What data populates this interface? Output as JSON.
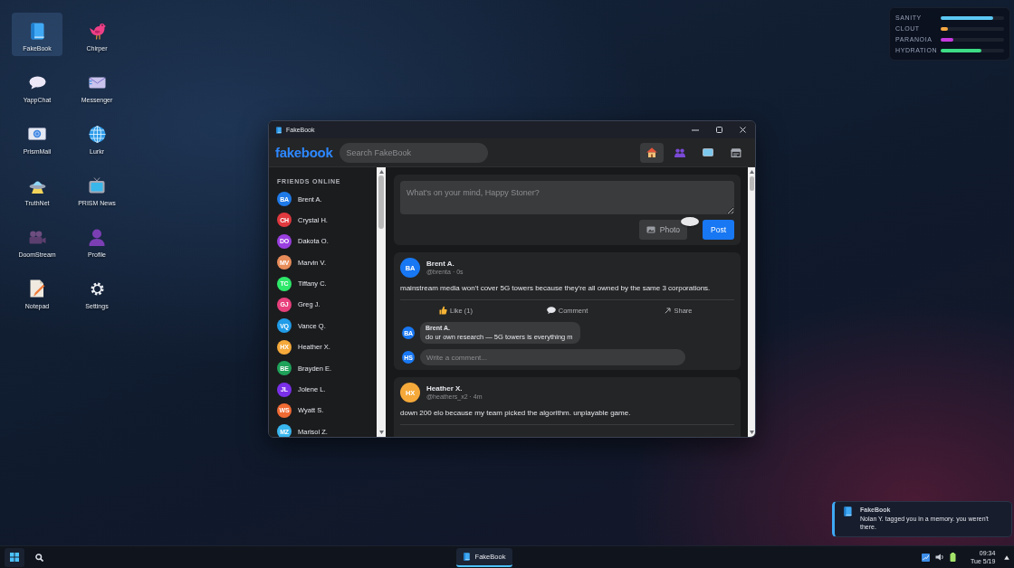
{
  "desktop_icons": [
    {
      "label": "FakeBook",
      "selected": true
    },
    {
      "label": "Chirper",
      "selected": false
    },
    {
      "label": "YappChat",
      "selected": false
    },
    {
      "label": "Messenger",
      "selected": false
    },
    {
      "label": "PrismMail",
      "selected": false
    },
    {
      "label": "Lurkr",
      "selected": false
    },
    {
      "label": "TruthNet",
      "selected": false
    },
    {
      "label": "PRISM News",
      "selected": false
    },
    {
      "label": "DoomStream",
      "selected": false
    },
    {
      "label": "Profile",
      "selected": false
    },
    {
      "label": "Notepad",
      "selected": false
    },
    {
      "label": "Settings",
      "selected": false
    }
  ],
  "status_meters": [
    {
      "label": "SANITY",
      "level": 0.83,
      "color": "#5cc8f4"
    },
    {
      "label": "CLOUT",
      "level": 0.11,
      "color": "#f5a742"
    },
    {
      "label": "PARANOIA",
      "level": 0.2,
      "color": "#c63ade"
    },
    {
      "label": "HYDRATION",
      "level": 0.64,
      "color": "#3ddc84"
    }
  ],
  "window": {
    "title": "FakeBook",
    "header": {
      "logo": "fakebook",
      "search": {
        "placeholder": "Search FakeBook"
      },
      "nav_tabs": [
        {
          "selected": true
        },
        {
          "selected": false
        },
        {
          "selected": false
        },
        {
          "selected": false
        }
      ]
    },
    "sidebar": {
      "heading": "FRIENDS ONLINE",
      "friends": [
        {
          "initials": "BA",
          "name": "Brent A.",
          "color": "#1f7ae8"
        },
        {
          "initials": "CH",
          "name": "Crystal H.",
          "color": "#e0393e"
        },
        {
          "initials": "DO",
          "name": "Dakota O.",
          "color": "#9a3fe0"
        },
        {
          "initials": "MV",
          "name": "Marvin V.",
          "color": "#e88d5a"
        },
        {
          "initials": "TC",
          "name": "Tiffany C.",
          "color": "#2ee86a"
        },
        {
          "initials": "GJ",
          "name": "Greg J.",
          "color": "#e8407c"
        },
        {
          "initials": "VQ",
          "name": "Vance Q.",
          "color": "#209ce8"
        },
        {
          "initials": "HX",
          "name": "Heather X.",
          "color": "#f5a93a"
        },
        {
          "initials": "BE",
          "name": "Brayden E.",
          "color": "#1fa25a"
        },
        {
          "initials": "JL",
          "name": "Jolene L.",
          "color": "#7a2fe8"
        },
        {
          "initials": "WS",
          "name": "Wyatt S.",
          "color": "#f06a33"
        },
        {
          "initials": "MZ",
          "name": "Marisol Z.",
          "color": "#3ab6ee"
        }
      ]
    },
    "composer": {
      "placeholder": "What's on your mind, Happy Stoner?",
      "buttons": [
        {
          "kind": "photo",
          "label": "Photo"
        },
        {
          "kind": "post",
          "label": "Post"
        }
      ]
    },
    "posts": [
      {
        "initials": "BA",
        "color": "#1877f2",
        "author": "Brent A.",
        "meta": "@brenta · 0s",
        "text": "mainstream media won't cover 5G towers because they're all owned by the same 3 corporations.",
        "actions": [
          {
            "kind": "like",
            "label": "Like (1)"
          },
          {
            "kind": "comment",
            "label": "Comment"
          },
          {
            "kind": "share",
            "label": "Share"
          }
        ],
        "comments": [
          {
            "initials": "BA",
            "color": "#1877f2",
            "author": "Brent A.",
            "text": "do ur own research — 5G towers is everything m"
          }
        ],
        "reply": {
          "initials": "HS",
          "color": "#1877f2",
          "placeholder": "Write a comment..."
        }
      },
      {
        "initials": "HX",
        "color": "#f5a93a",
        "author": "Heather X.",
        "meta": "@heathers_x2 · 4m",
        "text": "down 200 elo because my team picked the algorithm. unplayable game."
      }
    ]
  },
  "notification": {
    "app": "FakeBook",
    "text": "Nolan Y. tagged you in a memory. you weren't there."
  },
  "taskbar": {
    "apps": [
      {
        "label": "FakeBook",
        "selected": true
      }
    ],
    "clock": {
      "time": "09:34",
      "date": "Tue 5/19"
    }
  }
}
